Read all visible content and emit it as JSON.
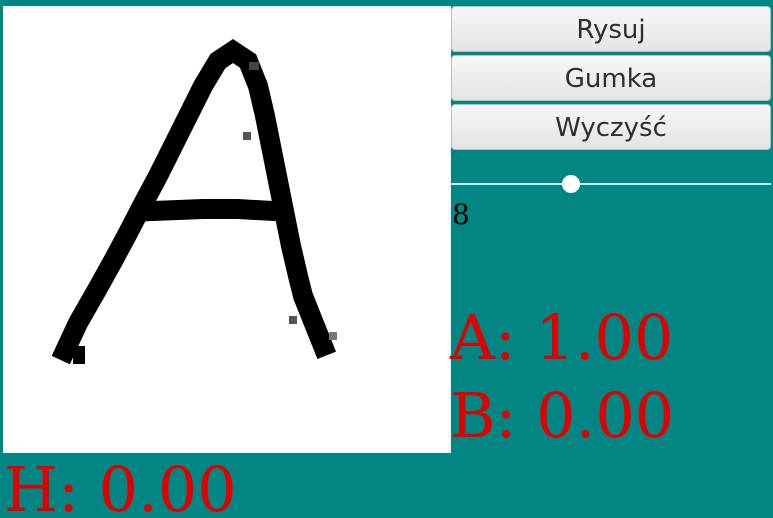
{
  "toolbar": {
    "draw_label": "Rysuj",
    "eraser_label": "Gumka",
    "clear_label": "Wyczyść"
  },
  "brush": {
    "size": "8"
  },
  "scores": {
    "a": "A: 1.00",
    "b": "B: 0.00",
    "h": "H: 0.00"
  },
  "colors": {
    "background": "#028684",
    "canvas": "#ffffff",
    "stroke": "#000000",
    "score_text": "#e00000"
  }
}
